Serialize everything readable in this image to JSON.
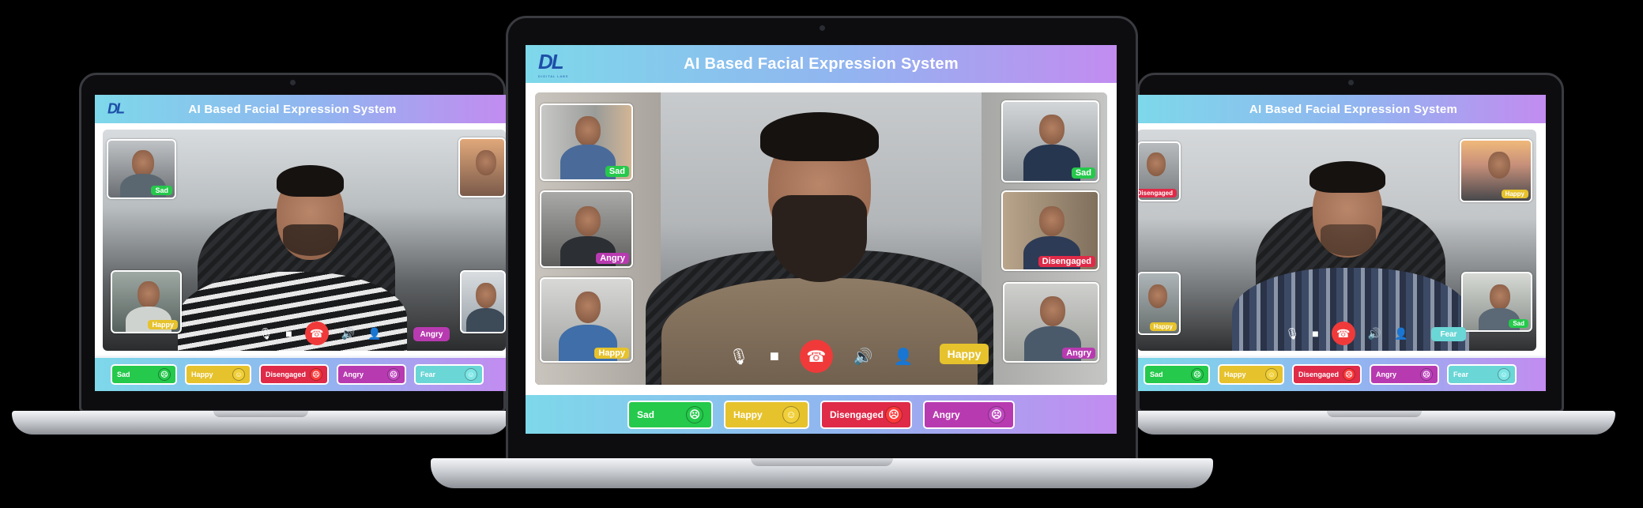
{
  "app": {
    "title": "AI Based Facial Expression System",
    "logo_text": "DL",
    "logo_subtext": "DIGITAL LABS"
  },
  "colors": {
    "sad": "#25c94b",
    "happy": "#e6c22c",
    "disengaged": "#df2a48",
    "angry": "#b83ab0",
    "fear": "#6ad6d6",
    "end_call": "#f03a3a"
  },
  "icons": {
    "mute": "mic-off-icon",
    "video": "video-camera-icon",
    "end_call": "phone-hangup-icon",
    "volume": "speaker-icon",
    "add_user": "add-user-icon"
  },
  "left_laptop": {
    "thumbs": [
      "Sad",
      "Happy",
      "",
      ""
    ],
    "main_badge": "Angry",
    "chips": [
      "Sad",
      "Happy",
      "Disengaged",
      "Angry",
      "Fear"
    ]
  },
  "center_laptop": {
    "thumbs": [
      "Sad",
      "Angry",
      "Happy",
      "Sad",
      "Disengaged",
      "Angry"
    ],
    "main_badge": "Happy",
    "chips": [
      "Sad",
      "Happy",
      "Disengaged",
      "Angry"
    ]
  },
  "right_laptop": {
    "thumbs": [
      "Disengaged",
      "Happy",
      "Happy",
      "Sad"
    ],
    "main_badge": "Fear",
    "chips": [
      "Sad",
      "Happy",
      "Disengaged",
      "Angry",
      "Fear"
    ]
  }
}
